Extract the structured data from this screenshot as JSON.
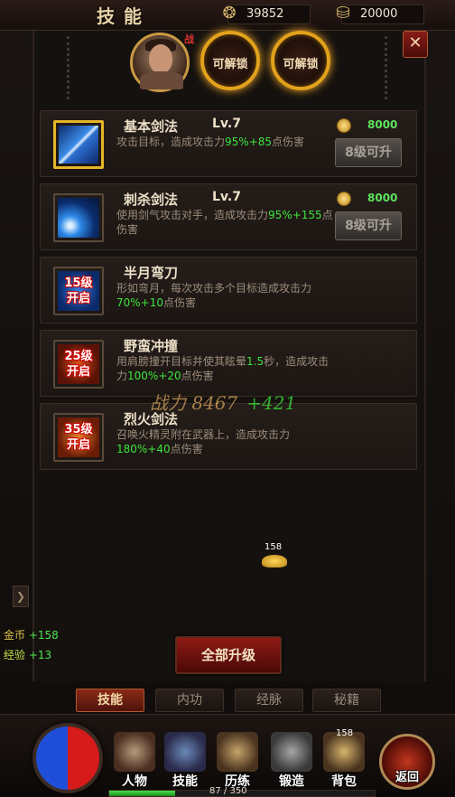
{
  "header": {
    "title": "技能",
    "gold_value": "39852",
    "ingot_value": "20000",
    "gold_icon": "gold-coin-icon",
    "ingot_icon": "ingot-icon"
  },
  "avatar": {
    "tag": "战"
  },
  "lock_slots": [
    "可解锁",
    "可解锁"
  ],
  "skills": [
    {
      "name": "基本剑法",
      "level": "Lv.7",
      "desc_a": "攻击目标，造成攻击力",
      "hl_a": "95%+85",
      "desc_b": "点伤害",
      "cost": "8000",
      "button": "8级可升",
      "lock": ""
    },
    {
      "name": "刺杀剑法",
      "level": "Lv.7",
      "desc_a": "使用剑气攻击对手，造成攻击力",
      "hl_a": "95%+155",
      "desc_b": "点伤害",
      "cost": "8000",
      "button": "8级可升",
      "lock": ""
    },
    {
      "name": "半月弯刀",
      "level": "",
      "desc_a": "形如弯月，每次攻击多个目标造成攻击力",
      "hl_a": "70%+10",
      "desc_b": "点伤害",
      "cost": "",
      "button": "",
      "lock_l1": "15级",
      "lock_l2": "开启"
    },
    {
      "name": "野蛮冲撞",
      "level": "",
      "desc_a": "用肩膀撞开目标并使其眩晕",
      "hl_pre": "1.5",
      "desc_mid": "秒，造成攻击力",
      "hl_a": "100%+20",
      "desc_b": "点伤害",
      "cost": "",
      "button": "",
      "lock_l1": "25级",
      "lock_l2": "开启"
    },
    {
      "name": "烈火剑法",
      "level": "",
      "desc_a": "召唤火精灵附在武器上，造成攻击力",
      "hl_a": "180%+40",
      "desc_b": "点伤害",
      "cost": "",
      "button": "",
      "lock_l1": "35级",
      "lock_l2": "开启"
    }
  ],
  "power": {
    "label": "战力",
    "value": "8467",
    "delta": "+421"
  },
  "gold_drop": "158",
  "log": {
    "gold_label": "金币",
    "gold_delta": "+158",
    "exp_label": "经验",
    "exp_delta": "+13"
  },
  "upgrade_all": "全部升级",
  "tabs": [
    "技能",
    "内功",
    "经脉",
    "秘籍"
  ],
  "nav": [
    {
      "label": "人物",
      "badge": ""
    },
    {
      "label": "技能",
      "badge": ""
    },
    {
      "label": "历练",
      "badge": ""
    },
    {
      "label": "锻造",
      "badge": ""
    },
    {
      "label": "背包",
      "badge": "158"
    }
  ],
  "return_label": "返回",
  "exp": {
    "text": "87 / 350",
    "current": 87,
    "max": 350
  }
}
